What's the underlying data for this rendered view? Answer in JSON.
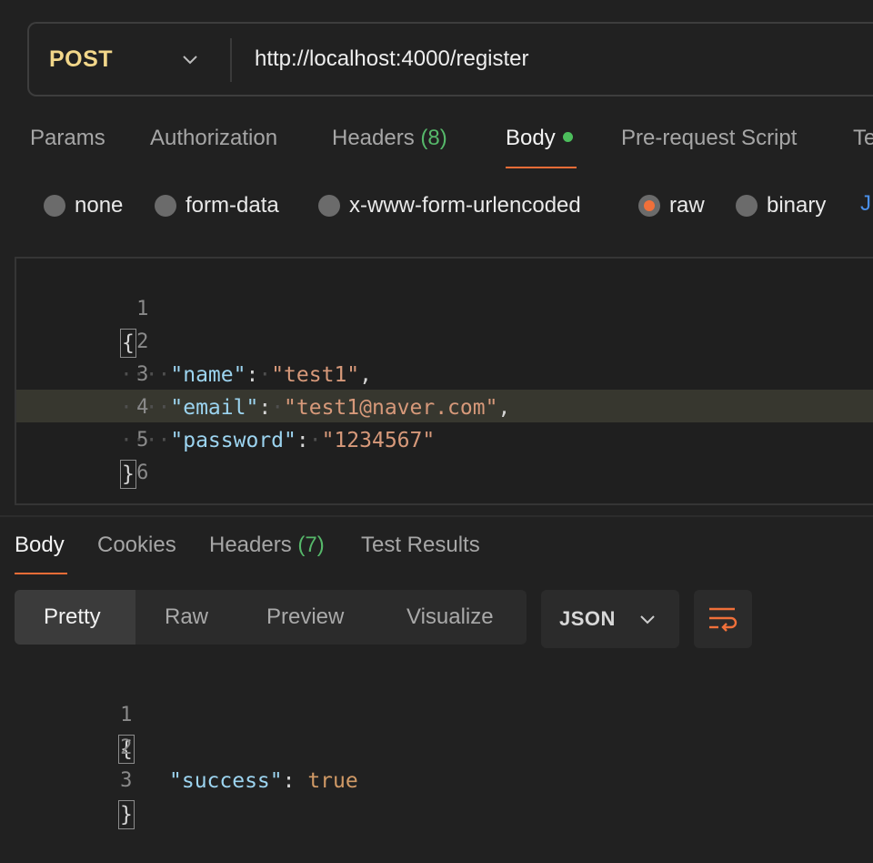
{
  "request": {
    "method": "POST",
    "url": "http://localhost:4000/register"
  },
  "request_tabs": [
    {
      "label": "Params"
    },
    {
      "label": "Authorization"
    },
    {
      "label": "Headers",
      "count": "(8)"
    },
    {
      "label": "Body",
      "active": true,
      "indicator": "green-dot"
    },
    {
      "label": "Pre-request Script"
    },
    {
      "label": "Te"
    }
  ],
  "body_types": [
    {
      "label": "none",
      "checked": false
    },
    {
      "label": "form-data",
      "checked": false
    },
    {
      "label": "x-www-form-urlencoded",
      "checked": false
    },
    {
      "label": "raw",
      "checked": true
    },
    {
      "label": "binary",
      "checked": false
    }
  ],
  "body_format_peek": "J",
  "request_body": {
    "line_numbers": [
      "1",
      "2",
      "3",
      "4",
      "5",
      "6"
    ],
    "open_brace": "{",
    "close_brace": "}",
    "fields": [
      {
        "key": "\"name\"",
        "value": "\"test1\"",
        "trailing": ","
      },
      {
        "key": "\"email\"",
        "value": "\"test1@naver.com\"",
        "trailing": ","
      },
      {
        "key": "\"password\"",
        "value": "\"1234567\"",
        "trailing": ""
      }
    ]
  },
  "response_tabs": [
    {
      "label": "Body",
      "active": true
    },
    {
      "label": "Cookies"
    },
    {
      "label": "Headers",
      "count": "(7)"
    },
    {
      "label": "Test Results"
    }
  ],
  "view_modes": [
    {
      "label": "Pretty",
      "active": true
    },
    {
      "label": "Raw"
    },
    {
      "label": "Preview"
    },
    {
      "label": "Visualize"
    }
  ],
  "response_format": "JSON",
  "response_body": {
    "line_numbers": [
      "1",
      "2",
      "3"
    ],
    "open_brace": "{",
    "close_brace": "}",
    "key": "\"success\"",
    "value": "true"
  },
  "icons": {
    "method_dropdown": "chevron-down-icon",
    "format_dropdown": "chevron-down-icon",
    "wrap": "wrap-lines-icon"
  },
  "colors": {
    "background": "#212121",
    "method": "#f2d78a",
    "accent": "#f16d37",
    "green": "#56b86a",
    "json_key": "#9cd4f0",
    "json_string": "#d7997a",
    "json_bool": "#d19a66"
  }
}
